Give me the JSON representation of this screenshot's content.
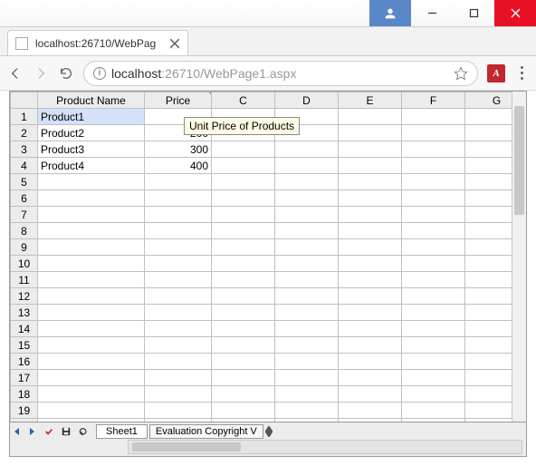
{
  "browser": {
    "tab_title": "localhost:26710/WebPag",
    "url_display_host": "localhost",
    "url_display_port": ":26710",
    "url_display_path": "/WebPage1.aspx",
    "extension_label": "A"
  },
  "sheet": {
    "columns": [
      "Product Name",
      "Price",
      "C",
      "D",
      "E",
      "F",
      "G"
    ],
    "row_count": 20,
    "data_rows": [
      {
        "a": "Product1",
        "b": ""
      },
      {
        "a": "Product2",
        "b": "200"
      },
      {
        "a": "Product3",
        "b": "300"
      },
      {
        "a": "Product4",
        "b": "400"
      }
    ],
    "comment_tooltip": "Unit Price of Products",
    "selected_cell": "A1"
  },
  "bottom": {
    "sheet_tab": "Sheet1",
    "eval_text": "Evaluation Copyright V"
  }
}
